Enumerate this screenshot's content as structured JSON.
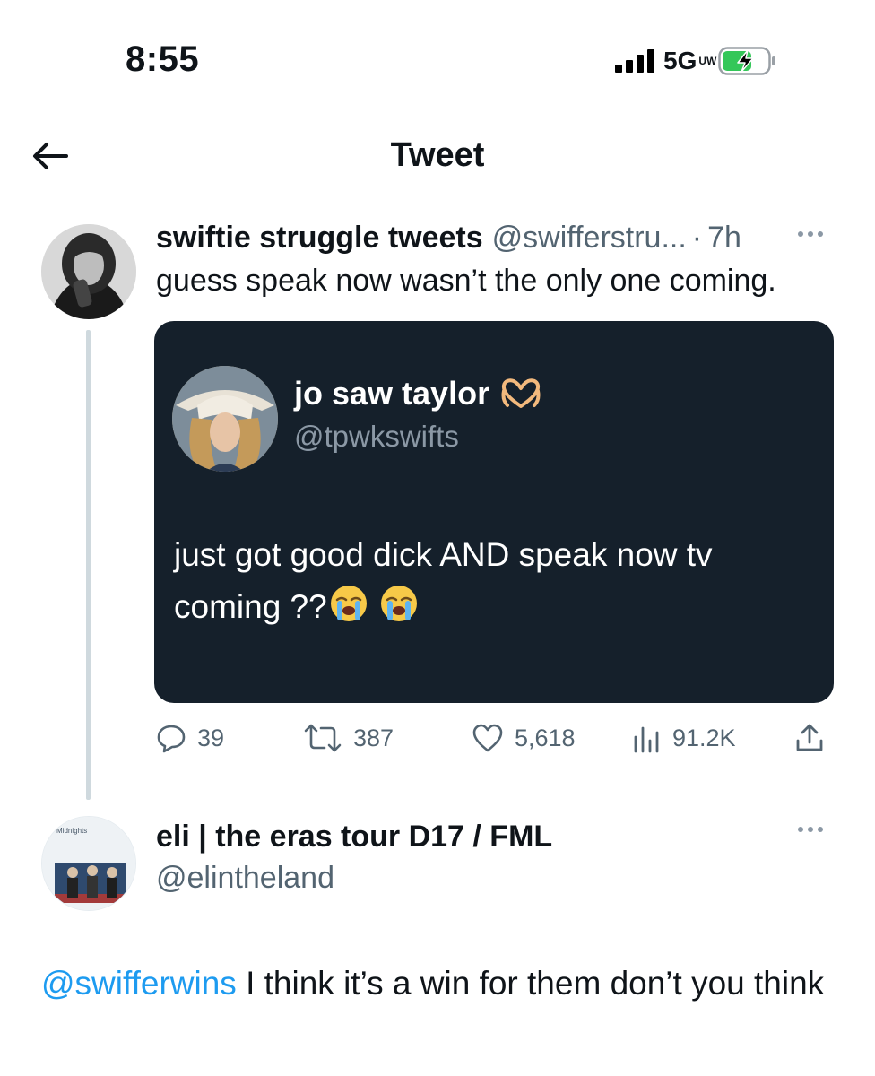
{
  "status_bar": {
    "time": "8:55",
    "network": "5G",
    "network_suffix": "UW"
  },
  "header": {
    "title": "Tweet"
  },
  "tweet": {
    "author_name": "swiftie struggle tweets",
    "author_handle": "@swifferstru...",
    "separator": "·",
    "time": "7h",
    "text": "guess speak now wasn’t the only one coming.",
    "embedded": {
      "author_name": "jo saw taylor",
      "author_handle": "@tpwkswifts",
      "text": "just got good dick AND speak now tv coming ??"
    },
    "stats": {
      "replies": "39",
      "retweets": "387",
      "likes": "5,618",
      "views": "91.2K"
    }
  },
  "reply": {
    "author_name": "eli | the eras tour D17 / FML",
    "author_handle": "@elintheland",
    "avatar_caption": "Midnights",
    "mention": "@swifferwins",
    "text": " I think it’s a win for them don’t you think"
  },
  "colors": {
    "accent": "#1d9bf0",
    "secondary_text": "#536471",
    "embed_bg": "#15202b",
    "thread_line": "#cfd9de"
  }
}
